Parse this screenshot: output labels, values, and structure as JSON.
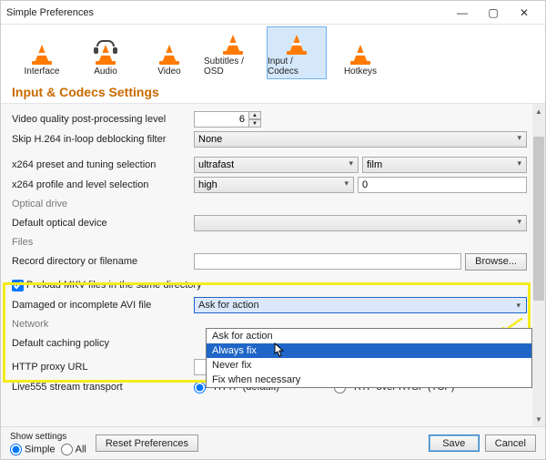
{
  "window": {
    "title": "Simple Preferences"
  },
  "toolbar": [
    {
      "label": "Interface"
    },
    {
      "label": "Audio"
    },
    {
      "label": "Video"
    },
    {
      "label": "Subtitles / OSD"
    },
    {
      "label": "Input / Codecs",
      "selected": true
    },
    {
      "label": "Hotkeys"
    }
  ],
  "heading": "Input & Codecs Settings",
  "rows": {
    "video_quality_label": "Video quality post-processing level",
    "video_quality_value": "6",
    "skip_h264_label": "Skip H.264 in-loop deblocking filter",
    "skip_h264_value": "None",
    "x264_preset_label": "x264 preset and tuning selection",
    "x264_preset_value": "ultrafast",
    "x264_tune_value": "film",
    "x264_profile_label": "x264 profile and level selection",
    "x264_profile_value": "high",
    "x264_level_value": "0",
    "optical_group": "Optical drive",
    "default_optical_label": "Default optical device",
    "default_optical_value": "",
    "files_group": "Files",
    "record_label": "Record directory or filename",
    "record_value": "",
    "browse_btn": "Browse...",
    "preload_mkv_label": "Preload MKV files in the same directory",
    "preload_mkv_checked": true,
    "avi_label": "Damaged or incomplete AVI file",
    "avi_value": "Ask for action",
    "avi_options": [
      "Ask for action",
      "Always fix",
      "Never fix",
      "Fix when necessary"
    ],
    "avi_highlight_index": 1,
    "network_group": "Network",
    "caching_label": "Default caching policy",
    "http_proxy_label": "HTTP proxy URL",
    "http_proxy_value": "",
    "live555_label": "Live555 stream transport",
    "live555_http": "HTTP (default)",
    "live555_rtp": "RTP over RTSP (TCP)"
  },
  "footer": {
    "show_settings_label": "Show settings",
    "simple_label": "Simple",
    "all_label": "All",
    "reset_btn": "Reset Preferences",
    "save_btn": "Save",
    "cancel_btn": "Cancel"
  }
}
